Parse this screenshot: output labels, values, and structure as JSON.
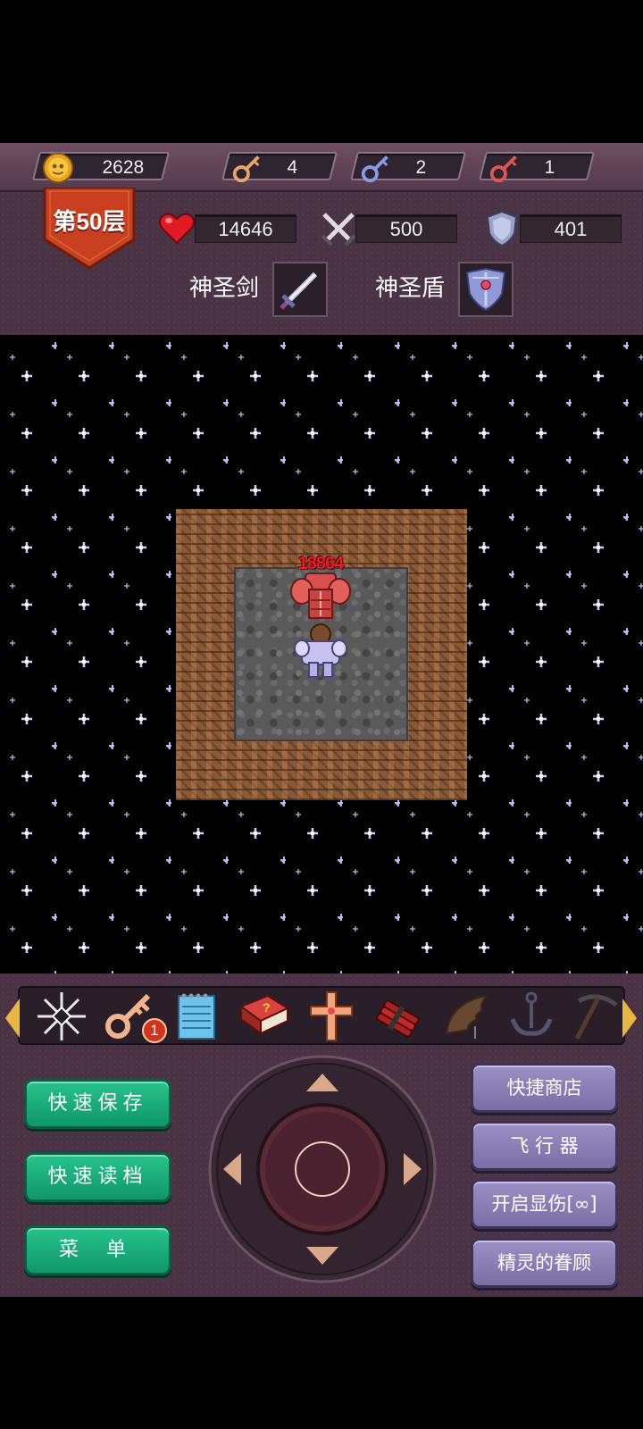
{
  "resources": {
    "gold": "2628",
    "yellow_keys": "4",
    "blue_keys": "2",
    "red_keys": "1"
  },
  "floor": {
    "label": "第50层"
  },
  "stats": {
    "hp": "14646",
    "attack": "500",
    "defense": "401"
  },
  "equipment": {
    "weapon_name": "神圣剑",
    "shield_name": "神圣盾"
  },
  "map": {
    "enemy_damage": "18864"
  },
  "toolbar": {
    "key_badge": "1"
  },
  "buttons": {
    "quick_save": "快速保存",
    "quick_load": "快速读档",
    "menu": "菜 单",
    "quick_shop": "快捷商店",
    "flyer": "飞 行 器",
    "show_damage": "开启显伤[∞]",
    "fairy_blessing": "精灵的眷顾"
  },
  "colors": {
    "hud_bg": "#4b3346",
    "green_button": "#1bb07c",
    "purple_button": "#8c80b8",
    "damage_text": "#e0202a",
    "floor_banner": "#c8401f"
  },
  "icons": [
    "gold-coin-icon",
    "yellow-key-icon",
    "blue-key-icon",
    "red-key-icon",
    "heart-icon",
    "crossed-swords-icon",
    "shield-icon",
    "sacred-sword-icon",
    "sacred-shield-icon",
    "snowflake-icon",
    "key-icon",
    "notebook-icon",
    "monster-manual-icon",
    "cross-icon",
    "dynamite-icon",
    "wing-icon",
    "anchor-icon",
    "pickaxe-icon"
  ]
}
